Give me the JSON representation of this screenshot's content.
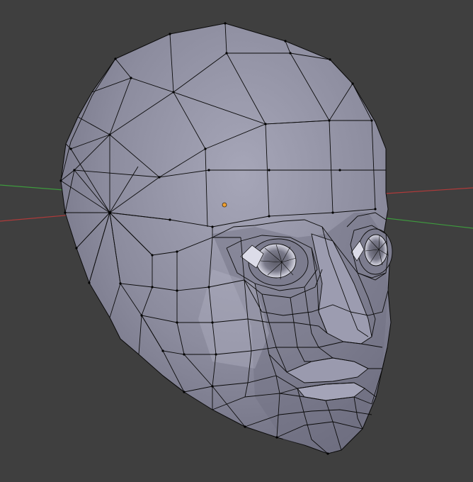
{
  "viewport": {
    "background": "#3f3f3f",
    "x_axis_color": "#b03a3a",
    "y_axis_color": "#3e9a3e",
    "mesh_face_color": "#8a8a9c",
    "mesh_edge_color": "#0a0a0a",
    "vertex_color": "#000000",
    "origin_color": "#f0a030",
    "object": "head-mesh",
    "shading": "solid",
    "mode": "edit-mode-wireframe-overlay"
  }
}
